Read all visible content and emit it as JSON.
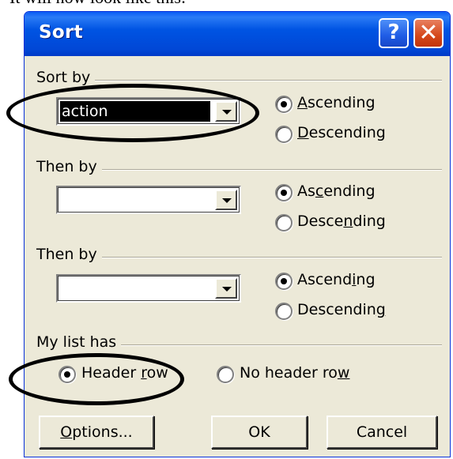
{
  "caption": "It will now look like this:",
  "dialog": {
    "title": "Sort",
    "help_label": "?",
    "close_label": "✕"
  },
  "sort_by": {
    "label": "Sort by",
    "value": "action",
    "ascending": {
      "pre": "",
      "key": "A",
      "post": "scending",
      "checked": true
    },
    "descending": {
      "pre": "",
      "key": "D",
      "post": "escending",
      "checked": false
    }
  },
  "then_by_1": {
    "label": "Then by",
    "value": "",
    "ascending": {
      "pre": "As",
      "key": "c",
      "post": "ending",
      "checked": true
    },
    "descending": {
      "pre": "Desce",
      "key": "n",
      "post": "ding",
      "checked": false
    }
  },
  "then_by_2": {
    "label": "Then by",
    "value": "",
    "ascending": {
      "pre": "Ascend",
      "key": "i",
      "post": "ng",
      "checked": true
    },
    "descending": {
      "pre": "Descendin",
      "key": "g",
      "post": "",
      "checked": false
    }
  },
  "list_has": {
    "label": "My list has",
    "header_row": {
      "pre": "Header ",
      "key": "r",
      "post": "ow",
      "checked": true
    },
    "no_header_row": {
      "pre": "No header ro",
      "key": "w",
      "post": "",
      "checked": false
    }
  },
  "buttons": {
    "options": {
      "pre": "",
      "key": "O",
      "post": "ptions..."
    },
    "ok": "OK",
    "cancel": "Cancel"
  }
}
